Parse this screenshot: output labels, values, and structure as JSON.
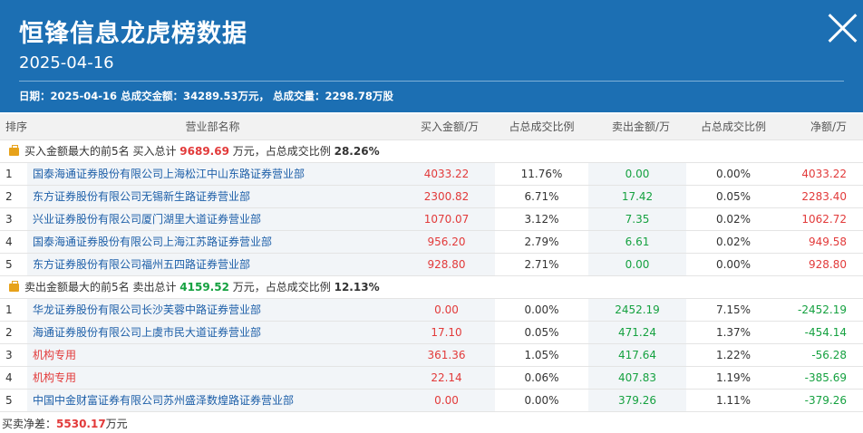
{
  "header": {
    "title": "恒锋信息龙虎榜数据",
    "date": "2025-04-16",
    "summary": "日期：2025-04-16 总成交金额：34289.53万元， 总成交量：2298.78万股"
  },
  "table": {
    "columns": [
      "排序",
      "营业部名称",
      "买入金额/万",
      "占总成交比例",
      "卖出金额/万",
      "占总成交比例",
      "净额/万"
    ],
    "buy_section": {
      "prefix": "买入金额最大的前5名 买入总计",
      "total": "9689.69",
      "unit_ratio": "万元，占总成交比例",
      "ratio": "28.26%"
    },
    "buy_rows": [
      {
        "rank": "1",
        "name": "国泰海通证券股份有限公司上海松江中山东路证券营业部",
        "buy": "4033.22",
        "buy_pct": "11.76%",
        "sell": "0.00",
        "sell_pct": "0.00%",
        "net": "4033.22"
      },
      {
        "rank": "2",
        "name": "东方证券股份有限公司无锡新生路证券营业部",
        "buy": "2300.82",
        "buy_pct": "6.71%",
        "sell": "17.42",
        "sell_pct": "0.05%",
        "net": "2283.40"
      },
      {
        "rank": "3",
        "name": "兴业证券股份有限公司厦门湖里大道证券营业部",
        "buy": "1070.07",
        "buy_pct": "3.12%",
        "sell": "7.35",
        "sell_pct": "0.02%",
        "net": "1062.72"
      },
      {
        "rank": "4",
        "name": "国泰海通证券股份有限公司上海江苏路证券营业部",
        "buy": "956.20",
        "buy_pct": "2.79%",
        "sell": "6.61",
        "sell_pct": "0.02%",
        "net": "949.58"
      },
      {
        "rank": "5",
        "name": "东方证券股份有限公司福州五四路证券营业部",
        "buy": "928.80",
        "buy_pct": "2.71%",
        "sell": "0.00",
        "sell_pct": "0.00%",
        "net": "928.80"
      }
    ],
    "sell_section": {
      "prefix": "卖出金额最大的前5名 卖出总计",
      "total": "4159.52",
      "unit_ratio": "万元，占总成交比例",
      "ratio": "12.13%"
    },
    "sell_rows": [
      {
        "rank": "1",
        "name": "华龙证券股份有限公司长沙芙蓉中路证券营业部",
        "buy": "0.00",
        "buy_pct": "0.00%",
        "sell": "2452.19",
        "sell_pct": "7.15%",
        "net": "-2452.19"
      },
      {
        "rank": "2",
        "name": "海通证券股份有限公司上虞市民大道证券营业部",
        "buy": "17.10",
        "buy_pct": "0.05%",
        "sell": "471.24",
        "sell_pct": "1.37%",
        "net": "-454.14"
      },
      {
        "rank": "3",
        "name": "机构专用",
        "buy": "361.36",
        "buy_pct": "1.05%",
        "sell": "417.64",
        "sell_pct": "1.22%",
        "net": "-56.28"
      },
      {
        "rank": "4",
        "name": "机构专用",
        "buy": "22.14",
        "buy_pct": "0.06%",
        "sell": "407.83",
        "sell_pct": "1.19%",
        "net": "-385.69"
      },
      {
        "rank": "5",
        "name": "中国中金财富证券有限公司苏州盛泽数煌路证券营业部",
        "buy": "0.00",
        "buy_pct": "0.00%",
        "sell": "379.26",
        "sell_pct": "1.11%",
        "net": "-379.26"
      }
    ]
  },
  "footer": {
    "label": "买卖净差：",
    "value": "5530.17",
    "unit": "万元"
  },
  "colors": {
    "header_bg": "#1c6fb3",
    "up": "#e23a3a",
    "down": "#15a140",
    "link": "#1d5fa8"
  }
}
